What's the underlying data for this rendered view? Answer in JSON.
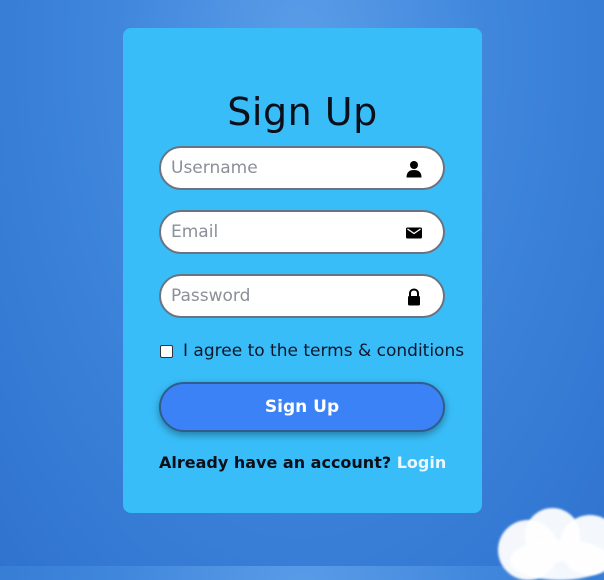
{
  "form": {
    "title": "Sign Up",
    "username_placeholder": "Username",
    "email_placeholder": "Email",
    "password_placeholder": "Password",
    "agree_label": "I agree to the terms & conditions",
    "submit_label": "Sign Up",
    "footer_text": "Already have an account?",
    "login_link": "Login",
    "username_icon": "user-icon",
    "email_icon": "envelope-icon",
    "password_icon": "lock-icon"
  },
  "colors": {
    "background": "#3f86dc",
    "card": "#39bdf8",
    "button": "#3b82f6",
    "link": "#eaf6ff"
  }
}
